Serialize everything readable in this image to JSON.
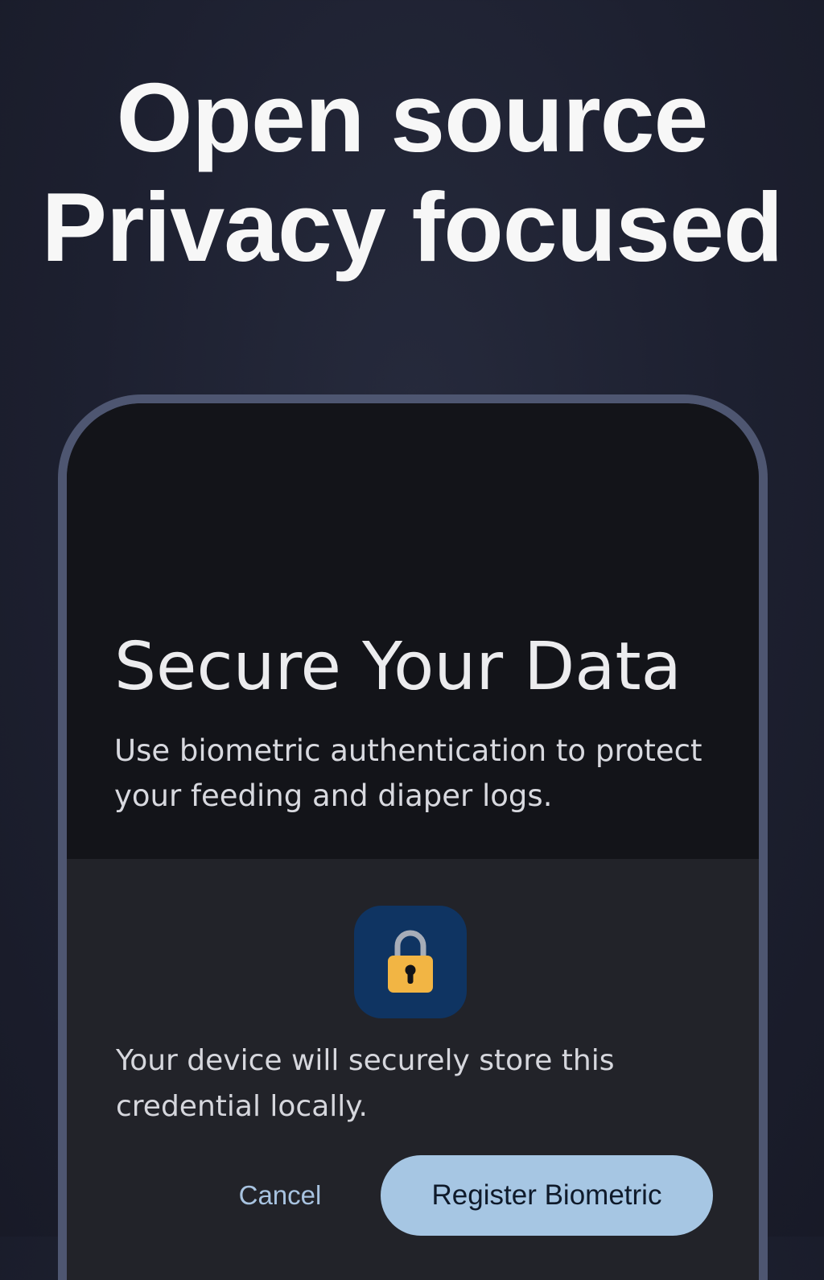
{
  "headline": {
    "line1": "Open source",
    "line2": "Privacy focused"
  },
  "screen": {
    "title": "Secure Your Data",
    "description": "Use biometric authentication to protect your feeding and diaper logs."
  },
  "dialog": {
    "icon": "lock-icon",
    "message": "Your device will securely store this credential locally.",
    "cancel_label": "Cancel",
    "register_label": "Register Biometric"
  },
  "colors": {
    "background": "#1d2030",
    "phone_frame": "#4e5671",
    "screen": "#131419",
    "dialog": "#222329",
    "icon_tile": "#0f3462",
    "lock_body": "#f2b544",
    "primary_button": "#a6c6e3",
    "cancel_text": "#a8c3e0"
  }
}
